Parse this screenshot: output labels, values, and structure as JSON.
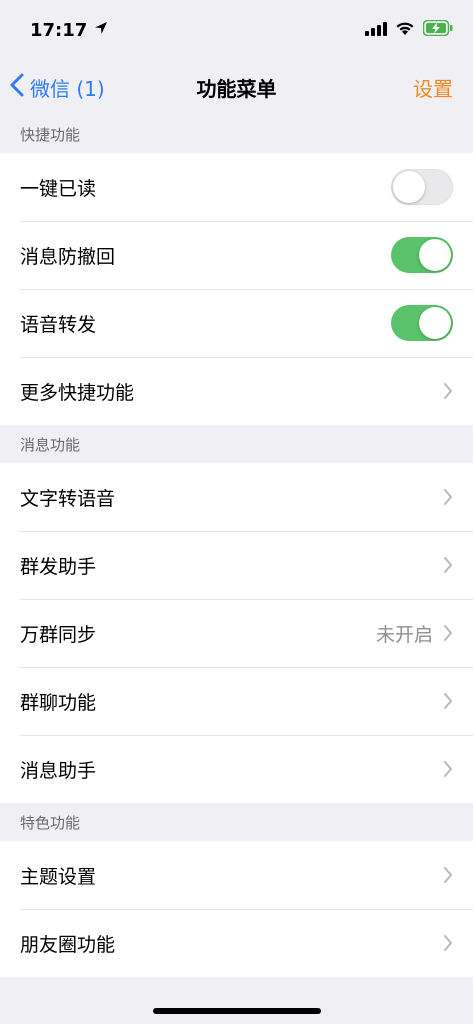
{
  "status_bar": {
    "time": "17:17"
  },
  "nav": {
    "back_label": "微信 (1)",
    "title": "功能菜单",
    "action_label": "设置"
  },
  "sections": [
    {
      "header": "快捷功能",
      "rows": [
        {
          "label": "一键已读",
          "toggle": false
        },
        {
          "label": "消息防撤回",
          "toggle": true
        },
        {
          "label": "语音转发",
          "toggle": true
        },
        {
          "label": "更多快捷功能"
        }
      ]
    },
    {
      "header": "消息功能",
      "rows": [
        {
          "label": "文字转语音"
        },
        {
          "label": "群发助手"
        },
        {
          "label": "万群同步",
          "value": "未开启"
        },
        {
          "label": "群聊功能"
        },
        {
          "label": "消息助手"
        }
      ]
    },
    {
      "header": "特色功能",
      "rows": [
        {
          "label": "主题设置"
        },
        {
          "label": "朋友圈功能"
        }
      ]
    }
  ],
  "colors": {
    "accent_blue": "#2F7BF6",
    "accent_orange": "#F08A24",
    "toggle_on": "#5AC26A",
    "background": "#EFEFF4"
  }
}
